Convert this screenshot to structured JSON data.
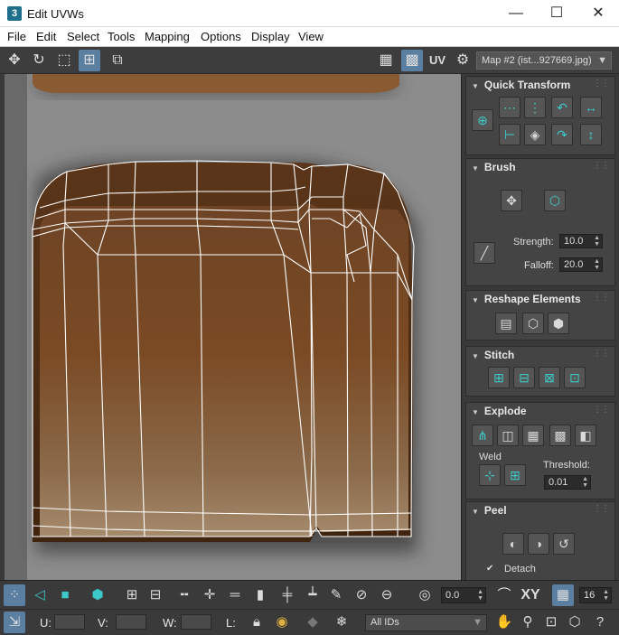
{
  "window": {
    "title": "Edit UVWs",
    "app_icon": "3",
    "minimize": "—",
    "maximize": "☐",
    "close": "✕"
  },
  "menu": [
    "File",
    "Edit",
    "Select",
    "Tools",
    "Mapping",
    "Options",
    "Display",
    "View"
  ],
  "toolbar": {
    "uv_label": "UV",
    "map_select": "Map #2 (ist...927669.jpg)"
  },
  "panel": {
    "quick_transform": {
      "title": "Quick Transform"
    },
    "brush": {
      "title": "Brush",
      "strength_label": "Strength:",
      "strength_value": "10.0",
      "falloff_label": "Falloff:",
      "falloff_value": "20.0"
    },
    "reshape": {
      "title": "Reshape Elements"
    },
    "stitch": {
      "title": "Stitch"
    },
    "explode": {
      "title": "Explode",
      "weld_label": "Weld",
      "threshold_label": "Threshold:",
      "threshold_value": "0.01"
    },
    "peel": {
      "title": "Peel",
      "detach_label": "Detach",
      "detach_checked": true
    }
  },
  "bottom": {
    "angle_value": "0.0",
    "xy_label": "XY",
    "grid_value": "16",
    "u_label": "U:",
    "v_label": "V:",
    "w_label": "W:",
    "l_label": "L:",
    "ids_select": "All IDs"
  },
  "colors": {
    "accent": "#3ec9c9",
    "selected": "#5b7fa0",
    "panel_bg": "#393939"
  }
}
